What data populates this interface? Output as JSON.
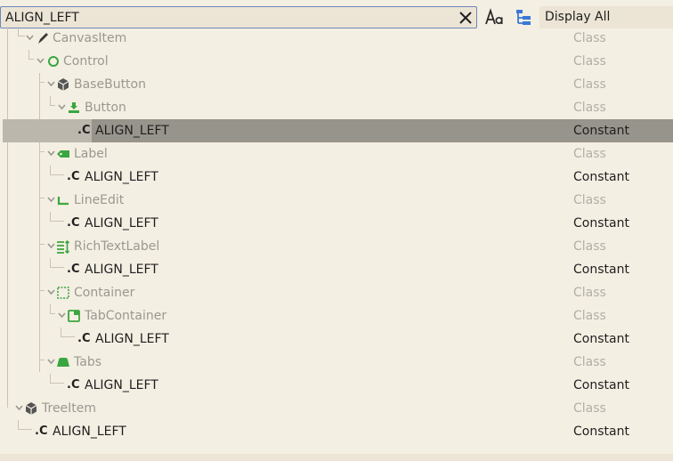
{
  "toolbar": {
    "search_value": "ALIGN_LEFT",
    "display_selected": "Display All"
  },
  "tree": {
    "rows": [
      {
        "label": "CanvasItem",
        "type": "Class"
      },
      {
        "label": "Control",
        "type": "Class"
      },
      {
        "label": "BaseButton",
        "type": "Class"
      },
      {
        "label": "Button",
        "type": "Class"
      },
      {
        "label": "ALIGN_LEFT",
        "type": "Constant",
        "prefix": ".C"
      },
      {
        "label": "Label",
        "type": "Class"
      },
      {
        "label": "ALIGN_LEFT",
        "type": "Constant",
        "prefix": ".C"
      },
      {
        "label": "LineEdit",
        "type": "Class"
      },
      {
        "label": "ALIGN_LEFT",
        "type": "Constant",
        "prefix": ".C"
      },
      {
        "label": "RichTextLabel",
        "type": "Class"
      },
      {
        "label": "ALIGN_LEFT",
        "type": "Constant",
        "prefix": ".C"
      },
      {
        "label": "Container",
        "type": "Class"
      },
      {
        "label": "TabContainer",
        "type": "Class"
      },
      {
        "label": "ALIGN_LEFT",
        "type": "Constant",
        "prefix": ".C"
      },
      {
        "label": "Tabs",
        "type": "Class"
      },
      {
        "label": "ALIGN_LEFT",
        "type": "Constant",
        "prefix": ".C"
      },
      {
        "label": "TreeItem",
        "type": "Class"
      },
      {
        "label": "ALIGN_LEFT",
        "type": "Constant",
        "prefix": ".C"
      }
    ]
  },
  "colors": {
    "accent_green": "#3aa63f",
    "selection": "#97948b",
    "search_border": "#6d87b8"
  },
  "icons": [
    "close-icon",
    "case-sensitive-icon",
    "hierarchy-icon",
    "pencil-icon",
    "circle-icon",
    "cube-icon",
    "button-icon",
    "label-tag-icon",
    "line-edit-icon",
    "rich-text-icon",
    "container-icon",
    "tab-container-icon",
    "tabs-icon"
  ]
}
